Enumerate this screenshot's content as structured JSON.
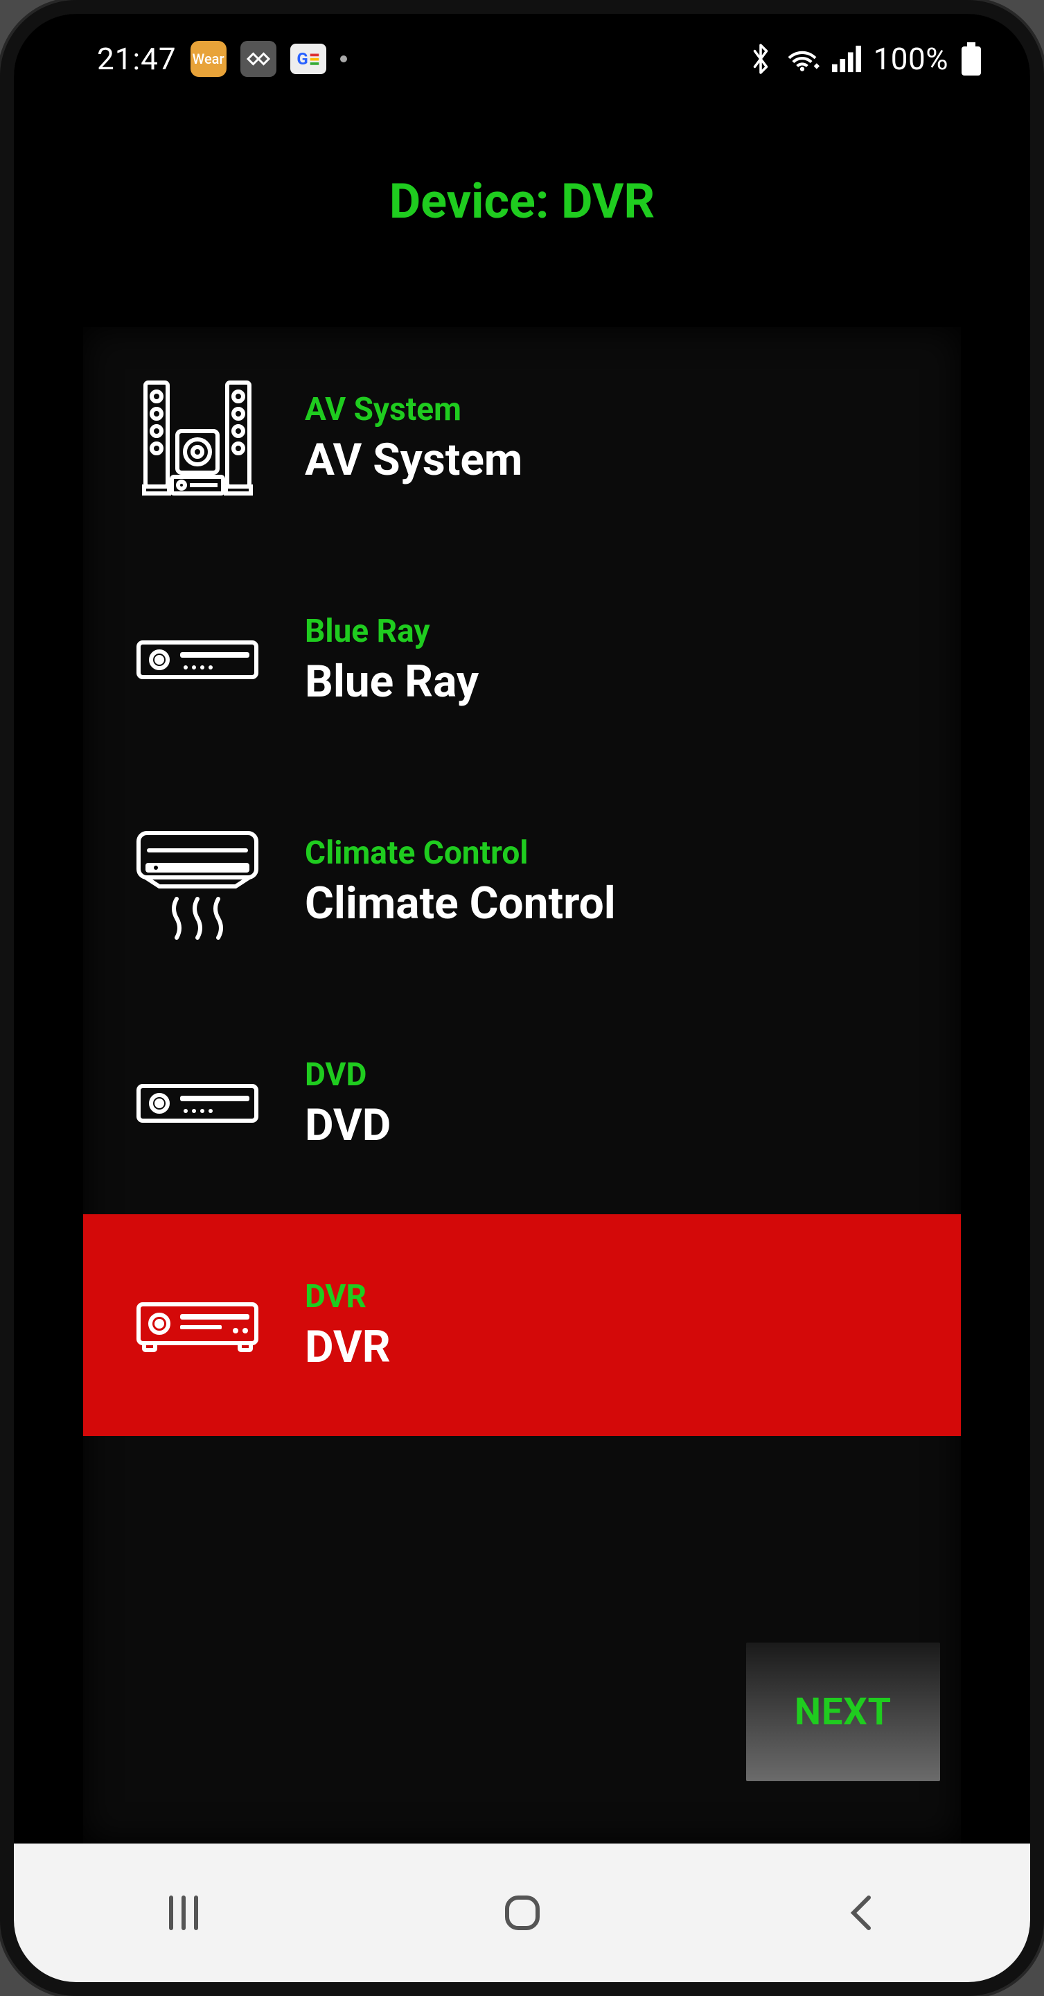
{
  "status": {
    "time": "21:47",
    "wear_label": "Wear",
    "news_label": "G",
    "battery_text": "100%"
  },
  "page": {
    "title": "Device: DVR"
  },
  "devices": [
    {
      "category": "AV System",
      "name": "AV System",
      "icon": "av-system-icon",
      "selected": false
    },
    {
      "category": "Blue Ray",
      "name": "Blue Ray",
      "icon": "blueray-icon",
      "selected": false
    },
    {
      "category": "Climate Control",
      "name": "Climate Control",
      "icon": "climate-icon",
      "selected": false
    },
    {
      "category": "DVD",
      "name": "DVD",
      "icon": "dvd-icon",
      "selected": false
    },
    {
      "category": "DVR",
      "name": "DVR",
      "icon": "dvr-icon",
      "selected": true
    }
  ],
  "next_button": "NEXT",
  "colors": {
    "accent_green": "#1fcc1f",
    "selected_red": "#d40909",
    "background": "#000000"
  }
}
